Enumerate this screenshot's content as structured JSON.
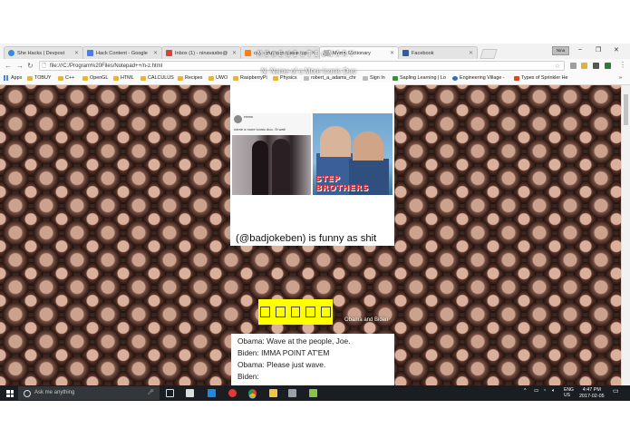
{
  "tabs": [
    {
      "title": "She Hacks | Devpost",
      "color": "#3a8bd6"
    },
    {
      "title": "Hack Content - Google",
      "color": "#4a7fe0"
    },
    {
      "title": "Inbox (1) - ninavasbo@",
      "color": "#d84535"
    },
    {
      "title": "css - Put icon inside inp",
      "color": "#f48024"
    },
    {
      "title": "Meme Dictionary",
      "color": "#bbbbbb"
    },
    {
      "title": "Facebook",
      "color": "#3b5998"
    }
  ],
  "window": {
    "profile_label": "Nina"
  },
  "omnibox": {
    "url": "file:///C:/Program%20Files/Notepad++/n-z.html"
  },
  "bookmarks": [
    {
      "label": "Apps",
      "kind": "apps"
    },
    {
      "label": "TOBUY",
      "kind": "folder"
    },
    {
      "label": "C++",
      "kind": "folder"
    },
    {
      "label": "OpenGL",
      "kind": "folder"
    },
    {
      "label": "HTML",
      "kind": "folder"
    },
    {
      "label": "CALCULUS",
      "kind": "folder"
    },
    {
      "label": "Recipes",
      "kind": "folder"
    },
    {
      "label": "UWO",
      "kind": "folder"
    },
    {
      "label": "RaspberryPi",
      "kind": "folder"
    },
    {
      "label": "Physics",
      "kind": "folder"
    },
    {
      "label": "robert_a_adams_chr",
      "kind": "file"
    },
    {
      "label": "Sign In",
      "kind": "file"
    },
    {
      "label": "Sapling Learning | Lo",
      "kind": "file"
    },
    {
      "label": "Engineering Village -",
      "kind": "file"
    },
    {
      "label": "Types of Sprinkler He",
      "kind": "file"
    }
  ],
  "page": {
    "site_title": "MEmEdIcTIoNARY",
    "definition": "N: Name of a More Iconic Duo",
    "tweet_name": "emma",
    "tweet_text": "name a more iconic duo. i'll wait",
    "step_brothers_text": "STEP BROTHERS",
    "caption": "(@badjokeben) is funny as shit",
    "yellow_boxes": [
      "□",
      "□",
      "□",
      "□",
      "□"
    ],
    "side_label": "Obama and Biden",
    "chat_lines": [
      "Obama: Wave at the people, Joe.",
      "Biden: IMMA POINT AT'EM",
      "Obama: Please just wave.",
      "Biden:"
    ]
  },
  "taskbar": {
    "search_placeholder": "Ask me anything",
    "lang": "ENG",
    "region": "US",
    "time": "4:47 PM",
    "date": "2017-02-05"
  }
}
